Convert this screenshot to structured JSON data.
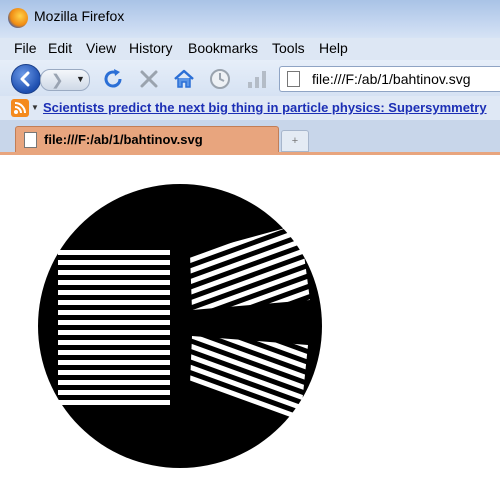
{
  "window": {
    "title": "Mozilla Firefox"
  },
  "menu": {
    "file": "File",
    "edit": "Edit",
    "view": "View",
    "history": "History",
    "bookmarks": "Bookmarks",
    "tools": "Tools",
    "help": "Help"
  },
  "navigation": {
    "icons": [
      "back-arrow-icon",
      "forward-arrow-icon",
      "reload-icon",
      "stop-icon",
      "home-icon",
      "history-clock-icon",
      "signal-bars-icon",
      "page-icon"
    ],
    "url": "file:///F:/ab/1/bahtinov.svg"
  },
  "bookmarks_bar": {
    "feed_icon": "rss-feed-icon",
    "link": "Scientists predict the next big thing in particle physics: Supersymmetry"
  },
  "tabs": {
    "active_label": "file:///F:/ab/1/bahtinov.svg",
    "new_tab_icon": "plus-icon"
  },
  "content": {
    "image_description_name": "bahtinov-mask",
    "colors": {
      "mask": "#000000",
      "background": "#ffffff"
    }
  }
}
